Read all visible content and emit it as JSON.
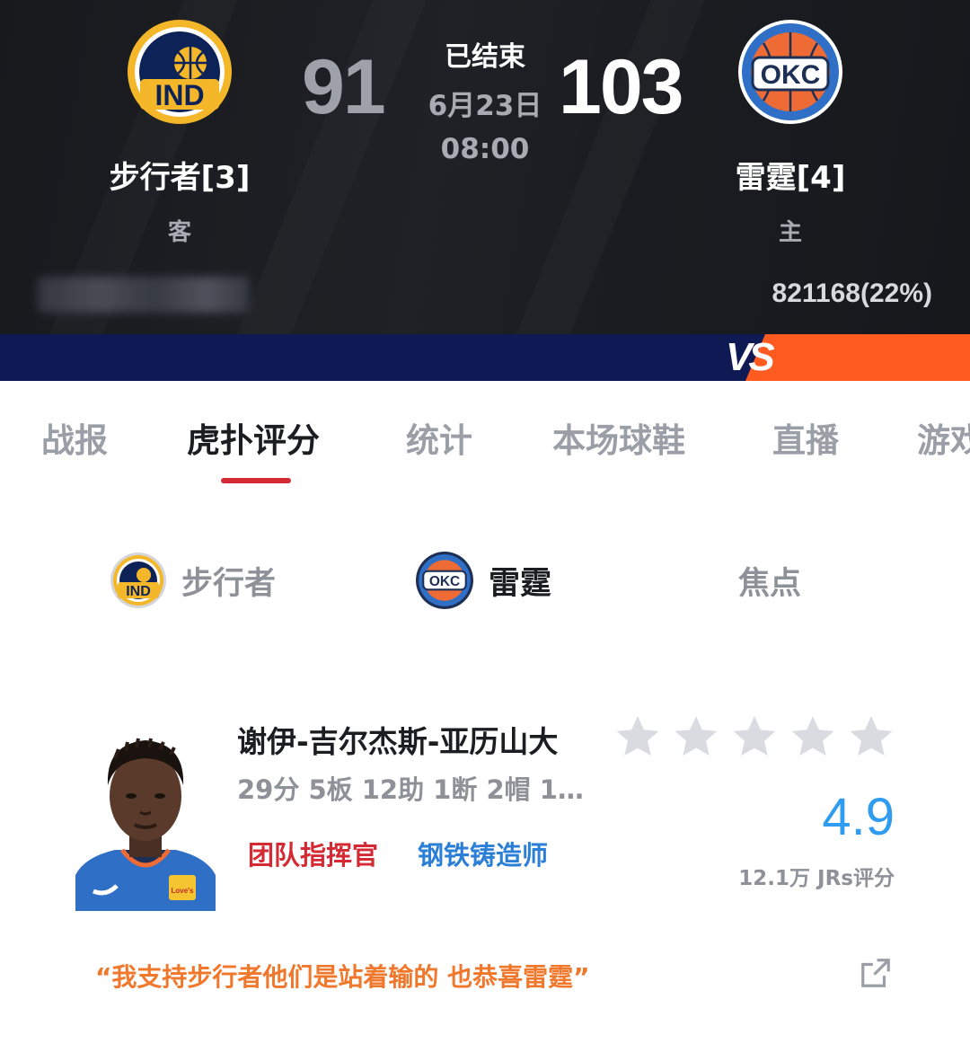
{
  "game": {
    "status": "已结束",
    "date": "6月23日",
    "time": "08:00"
  },
  "away_team": {
    "abbr": "IND",
    "name": "步行者[3]",
    "role": "客",
    "score": "91",
    "color": "#f5b72a",
    "ring_color": "#0d2357"
  },
  "home_team": {
    "abbr": "OKC",
    "name": "雷霆[4]",
    "role": "主",
    "score": "103",
    "color": "#2f6fc6",
    "accent": "#ef6b35",
    "vote": "821168(22%)"
  },
  "vs_label": "VS",
  "tabs": [
    "战报",
    "虎扑评分",
    "统计",
    "本场球鞋",
    "直播",
    "游戏"
  ],
  "active_tab": "虎扑评分",
  "sub_tabs": {
    "away": "步行者",
    "home": "雷霆",
    "focus": "焦点"
  },
  "player": {
    "name": "谢伊-吉尔杰斯-亚历山大",
    "stats": "29分  5板  12助  1断  2帽  1…",
    "tag_1": "团队指挥官",
    "tag_2": "钢铁铸造师",
    "rating": "4.9",
    "rating_count": "12.1万 JRs评分",
    "stars_filled": 0,
    "jersey_text": "Love's"
  },
  "quote": "“我支持步行者他们是站着输的  也恭喜雷霆”",
  "colors": {
    "header_bg": "#1c1e23",
    "vs_left": "#0f1a55",
    "vs_right": "#ff5a1f",
    "tab_underline": "#d42a34",
    "rating": "#2f9cf0",
    "quote": "#f0782c",
    "tag_red": "#d42a34",
    "tag_blue": "#2b7fd6"
  },
  "icons": {
    "share": "share-external-icon",
    "star": "star-icon"
  }
}
